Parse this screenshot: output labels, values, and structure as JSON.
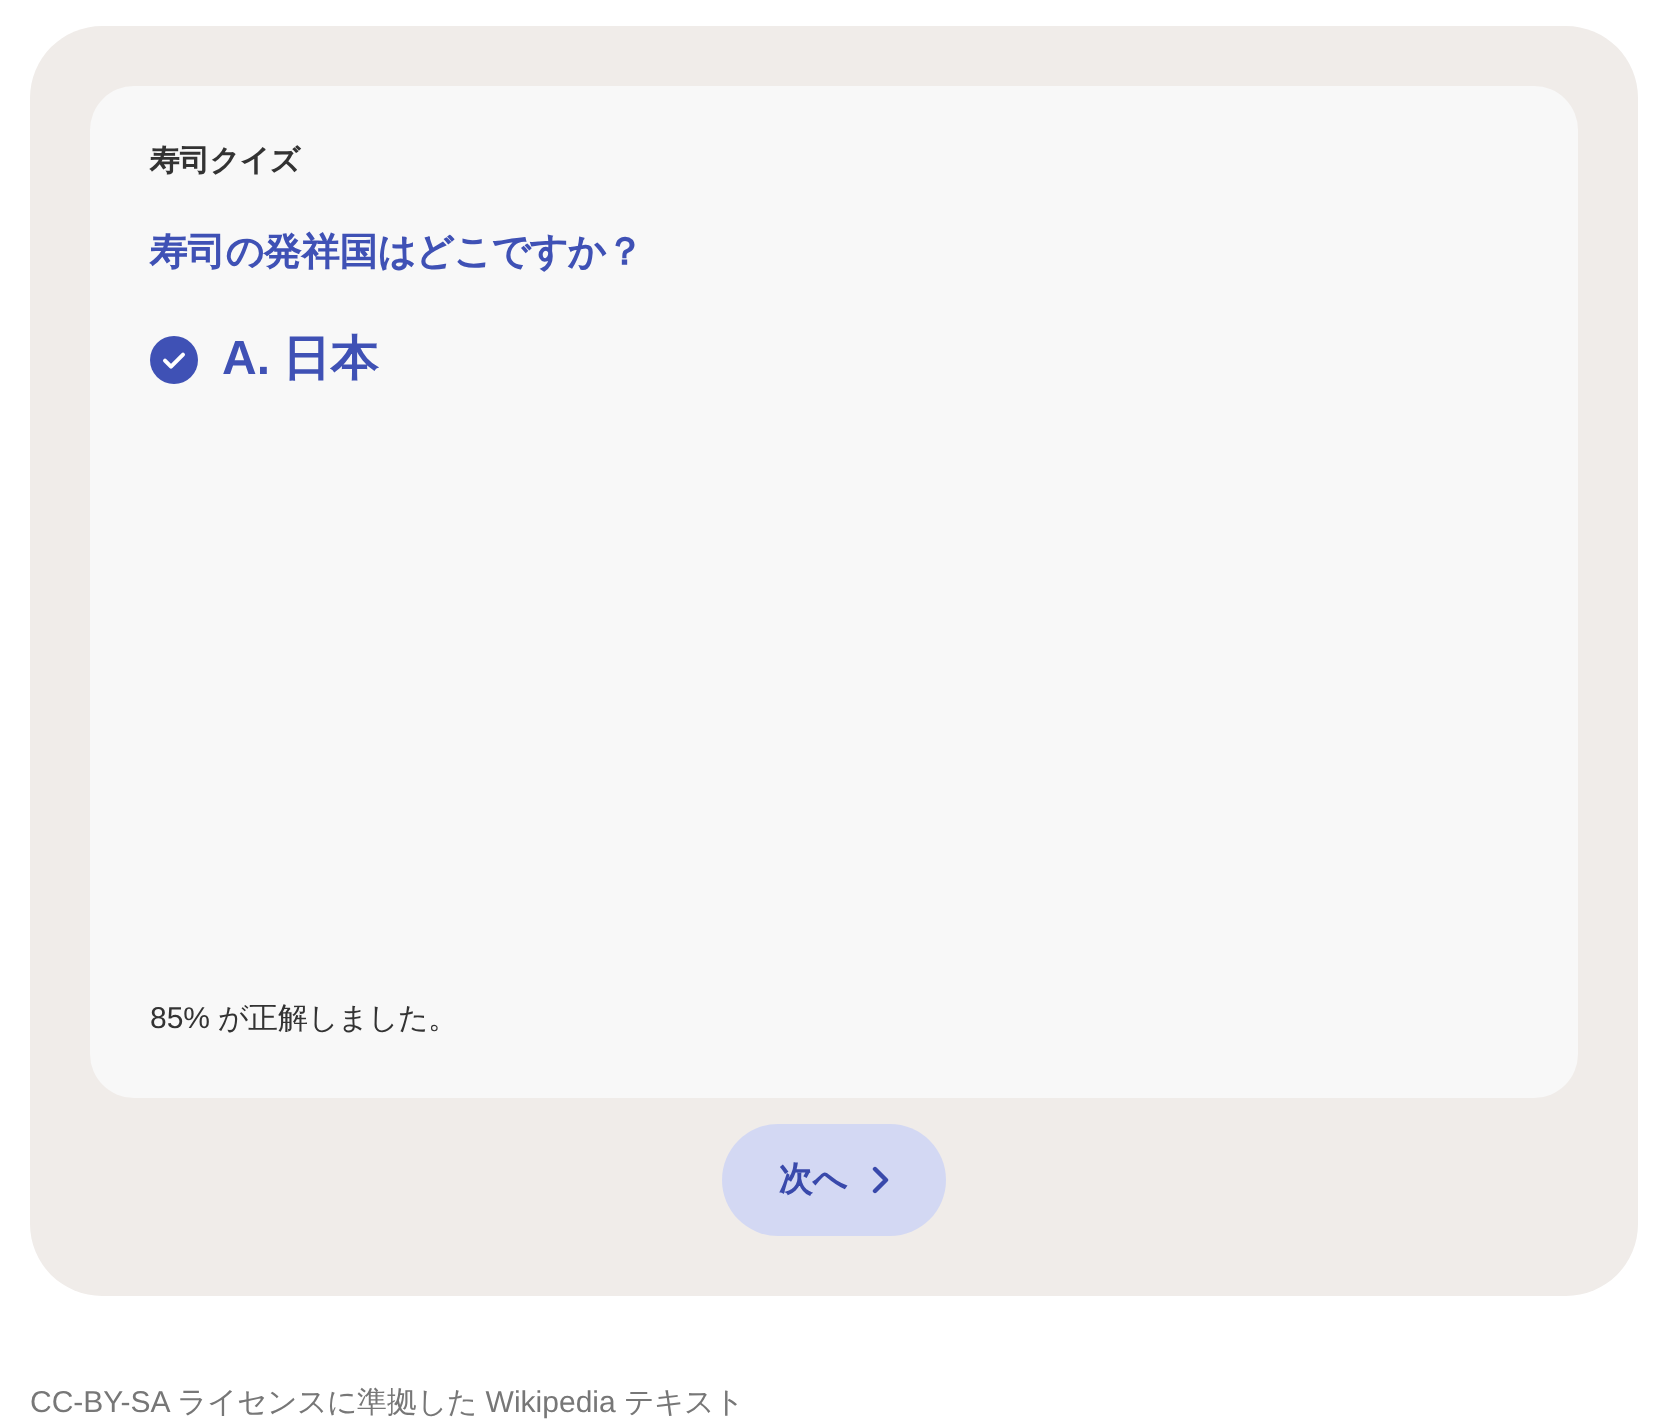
{
  "quiz": {
    "title": "寿司クイズ",
    "question": "寿司の発祥国はどこですか？",
    "answers": [
      {
        "label": "A. 日本",
        "selected": true
      }
    ],
    "result": "85% が正解しました。"
  },
  "next_button": {
    "label": "次へ"
  },
  "footer": "CC-BY-SA ライセンスに準拠した Wikipedia テキスト"
}
